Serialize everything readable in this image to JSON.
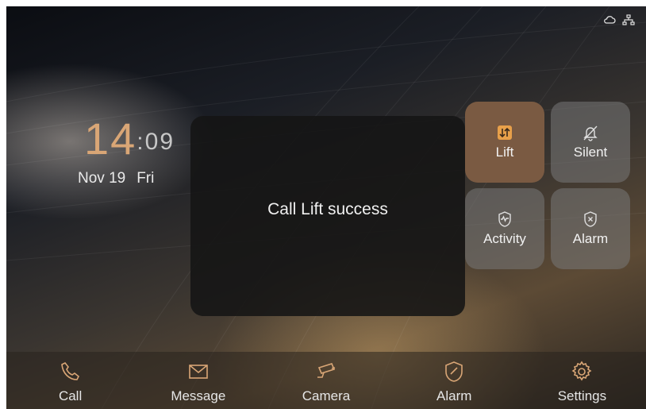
{
  "status_icons": [
    "cloud-icon",
    "network-icon"
  ],
  "clock": {
    "hours": "14",
    "colon": ":",
    "minutes": "09"
  },
  "date": {
    "day": "Nov 19",
    "weekday": "Fri"
  },
  "toast": {
    "message": "Call Lift success"
  },
  "quick_tiles": [
    {
      "label": "Lift",
      "icon": "lift-icon",
      "active": true
    },
    {
      "label": "Silent",
      "icon": "bell-off-icon",
      "active": false
    },
    {
      "label": "Activity",
      "icon": "activity-shield-icon",
      "active": false
    },
    {
      "label": "Alarm",
      "icon": "alarm-shield-icon",
      "active": false
    }
  ],
  "dock": [
    {
      "label": "Call",
      "icon": "phone-icon"
    },
    {
      "label": "Message",
      "icon": "envelope-icon"
    },
    {
      "label": "Camera",
      "icon": "camera-icon"
    },
    {
      "label": "Alarm",
      "icon": "shield-icon"
    },
    {
      "label": "Settings",
      "icon": "gear-icon"
    }
  ],
  "colors": {
    "accent": "#d9a676",
    "active_tile": "#7a5a42",
    "icon": "#e0e0e0"
  }
}
